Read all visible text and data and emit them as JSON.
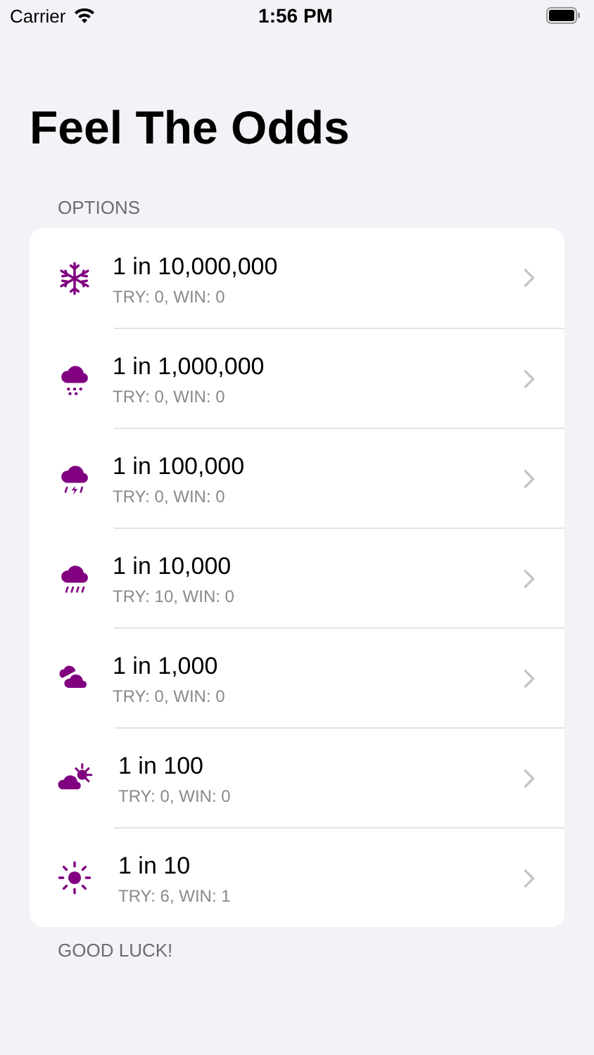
{
  "status_bar": {
    "carrier": "Carrier",
    "time": "1:56 PM"
  },
  "title": "Feel The Odds",
  "section_header": "OPTIONS",
  "options": [
    {
      "kind": "snowflake",
      "title": "1 in 10,000,000",
      "stats": "TRY: 0, WIN: 0"
    },
    {
      "kind": "snow",
      "title": "1 in 1,000,000",
      "stats": "TRY: 0, WIN: 0"
    },
    {
      "kind": "storm",
      "title": "1 in 100,000",
      "stats": "TRY: 0, WIN: 0"
    },
    {
      "kind": "rain",
      "title": "1 in 10,000",
      "stats": "TRY: 10, WIN: 0"
    },
    {
      "kind": "clouds",
      "title": "1 in 1,000",
      "stats": "TRY: 0, WIN: 0"
    },
    {
      "kind": "partly",
      "title": "1 in 100",
      "stats": "TRY: 0, WIN: 0"
    },
    {
      "kind": "sun",
      "title": "1 in 10",
      "stats": "TRY: 6, WIN: 1"
    }
  ],
  "section_footer": "GOOD LUCK!"
}
